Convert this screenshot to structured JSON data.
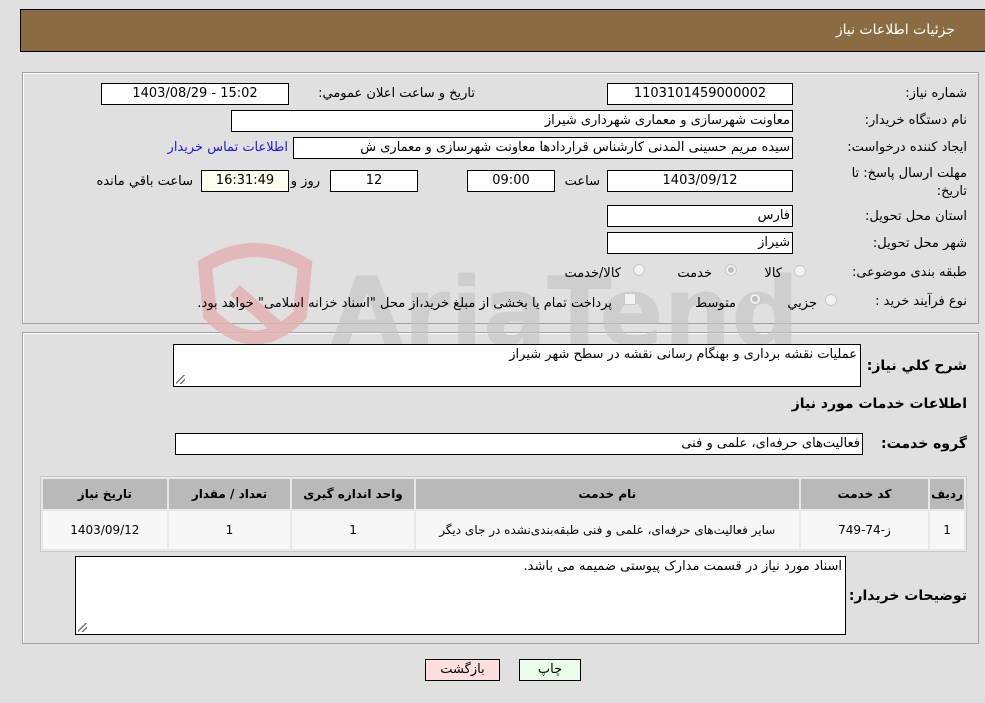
{
  "header": {
    "title": "جزئیات اطلاعات نیاز"
  },
  "form": {
    "need_number": {
      "label": "شماره نیاز:",
      "value": "1103101459000002"
    },
    "announce_datetime": {
      "label": "تاریخ و ساعت اعلان عمومي:",
      "value": "1403/08/29 - 15:02"
    },
    "buyer_org": {
      "label": "نام دستگاه خریدار:",
      "value": "معاونت شهرسازی و معماری شهرداری شیراز"
    },
    "requester": {
      "label": "ایجاد کننده درخواست:",
      "value": "سیده مریم حسینی المدنی کارشناس قراردادها معاونت شهرسازی و معماری ش"
    },
    "buyer_contact_link": "اطلاعات تماس خریدار",
    "deadline": {
      "label": "مهلت ارسال پاسخ: تا تاریخ:",
      "date": "1403/09/12",
      "time_label": "ساعت",
      "time": "09:00",
      "days": "12",
      "days_label": "روز و",
      "remaining": "16:31:49",
      "remaining_label": "ساعت باقي مانده"
    },
    "province": {
      "label": "استان محل تحویل:",
      "value": "فارس"
    },
    "city": {
      "label": "شهر محل تحویل:",
      "value": "شیراز"
    },
    "category": {
      "label": "طبقه بندی موضوعی:",
      "options": [
        "کالا",
        "خدمت",
        "کالا/خدمت"
      ],
      "selected": "خدمت"
    },
    "purchase_type": {
      "label": "نوع فرآیند خرید :",
      "options": [
        "جزيي",
        "متوسط"
      ],
      "selected": "متوسط",
      "treasury_note": "پرداخت تمام یا بخشی از مبلغ خرید،از محل \"اسناد خزانه اسلامی\" خواهد بود."
    }
  },
  "details": {
    "description_label": "شرح کلي نیاز:",
    "description": "عملیات نقشه برداری و بهنگام رسانی نقشه در سطح شهر شیراز",
    "services_heading": "اطلاعات خدمات مورد نیاز",
    "service_group_label": "گروه خدمت:",
    "service_group": "فعالیت‌های حرفه‌ای، علمی و فنی",
    "table": {
      "headers": [
        "ردیف",
        "کد خدمت",
        "نام خدمت",
        "واحد اندازه گیری",
        "تعداد / مقدار",
        "تاریخ نیاز"
      ],
      "rows": [
        [
          "1",
          "ز-74-749",
          "سایر فعالیت‌های حرفه‌ای، علمی و فنی طبقه‌بندی‌نشده در جای دیگر",
          "1",
          "1",
          "1403/09/12"
        ]
      ]
    },
    "buyer_notes_label": "توضیحات خریدار:",
    "buyer_notes": "اسناد مورد نیاز در قسمت مدارک پیوستی ضمیمه می باشد."
  },
  "buttons": {
    "print": "چاپ",
    "back": "بازگشت"
  },
  "colors": {
    "header_bg": "#8b6c42",
    "print_bg": "#eaffea",
    "back_bg": "#ffdede",
    "link": "#1a1adb"
  },
  "watermark": {
    "text": "AriaTender.neT"
  }
}
